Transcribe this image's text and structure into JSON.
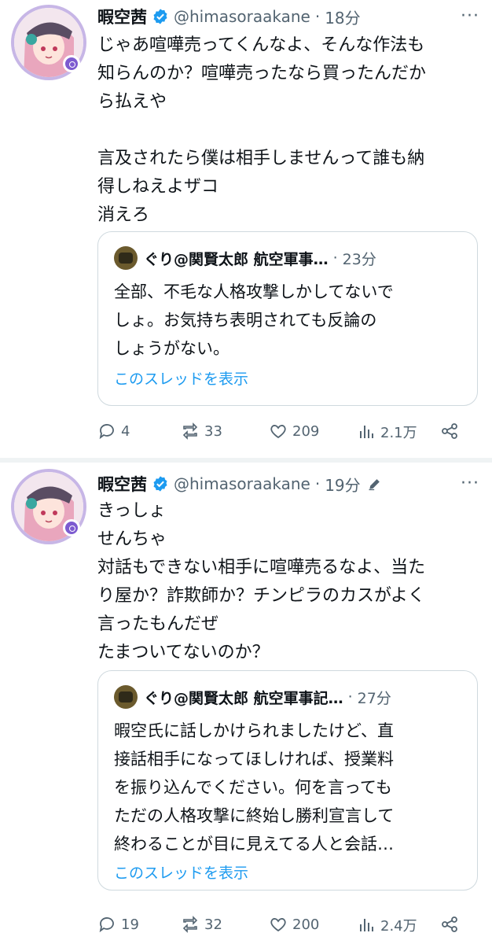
{
  "tweets": [
    {
      "name": "暇空茜",
      "handle": "@himasoraakane",
      "dot": "·",
      "time": "18分",
      "more": "···",
      "body": "じゃあ喧嘩売ってくんなよ、そんな作法も\n知らんのか？喧嘩売ったなら買ったんだか\nら払えや\n\n言及されたら僕は相手しませんって誰も納\n得しねえよザコ\n消えろ",
      "quote": {
        "name": "ぐり@関賢太郎 航空軍事…",
        "dot": "·",
        "time": "23分",
        "body": "全部、不毛な人格攻撃しかしてないで\nしょ。お気持ち表明されても反論の\nしょうがない。",
        "link": "このスレッドを表示"
      },
      "actions": {
        "replies": "4",
        "retweets": "33",
        "likes": "209",
        "views": "2.1万"
      }
    },
    {
      "name": "暇空茜",
      "handle": "@himasoraakane",
      "dot": "·",
      "time": "19分",
      "more": "···",
      "body": "きっしょ\nせんちゃ\n対話もできない相手に喧嘩売るなよ、当た\nり屋か？詐欺師か？チンピラのカスがよく\n言ったもんだぜ\nたまついてないのか？",
      "quote": {
        "name": "ぐり@関賢太郎 航空軍事記…",
        "dot": "·",
        "time": "27分",
        "body": "暇空氏に話しかけられましたけど、直\n接話相手になってほしければ、授業料\nを振り込んでください。何を言っても\nただの人格攻撃に終始し勝利宣言して\n終わることが目に見えてる人と会話…",
        "link": "このスレッドを表示"
      },
      "actions": {
        "replies": "19",
        "retweets": "32",
        "likes": "200",
        "views": "2.4万"
      }
    }
  ],
  "colors": {
    "link": "#1d9bf0",
    "muted": "#536471",
    "verified": "#1d9bf0",
    "border": "#cfd9de"
  }
}
